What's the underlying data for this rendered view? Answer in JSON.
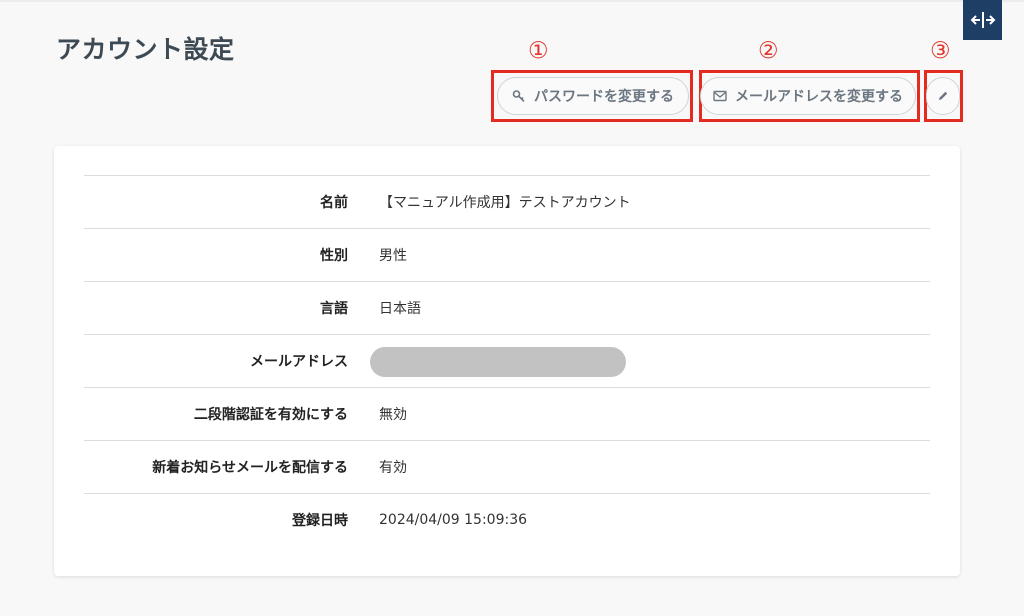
{
  "page": {
    "title": "アカウント設定"
  },
  "annotations": {
    "one": "①",
    "two": "②",
    "three": "③"
  },
  "actions": {
    "change_password": "パスワードを変更する",
    "change_email": "メールアドレスを変更する",
    "edit_icon": "pencil-icon"
  },
  "icons": {
    "key": "key-icon",
    "mail": "envelope-icon",
    "resize": "horizontal-resize-icon"
  },
  "account": {
    "rows": [
      {
        "label": "名前",
        "value": "【マニュアル作成用】テストアカウント"
      },
      {
        "label": "性別",
        "value": "男性"
      },
      {
        "label": "言語",
        "value": "日本語"
      },
      {
        "label": "メールアドレス",
        "value": ""
      },
      {
        "label": "二段階認証を有効にする",
        "value": "無効"
      },
      {
        "label": "新着お知らせメールを配信する",
        "value": "有効"
      },
      {
        "label": "登録日時",
        "value": "2024/04/09 15:09:36"
      }
    ]
  },
  "colors": {
    "annotation_red": "#e32b22",
    "corner_button": "#1e3e66",
    "title": "#3d4a54"
  }
}
